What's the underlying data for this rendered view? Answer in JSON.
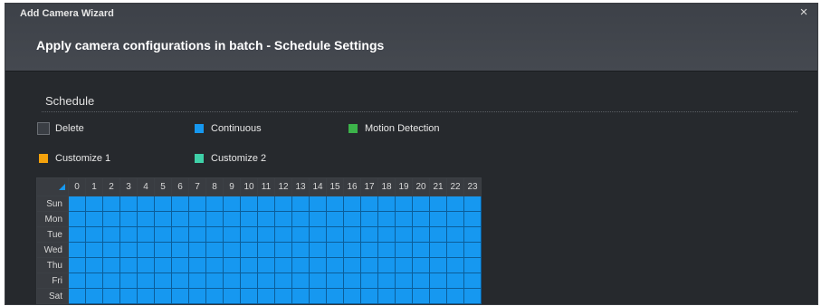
{
  "window": {
    "title": "Add Camera Wizard",
    "close_glyph": "×"
  },
  "heading": "Apply camera configurations in batch - Schedule Settings",
  "section": {
    "label": "Schedule"
  },
  "legend": {
    "delete": {
      "label": "Delete",
      "color": "#3a3e44"
    },
    "continuous": {
      "label": "Continuous",
      "color": "#1698f0"
    },
    "motion": {
      "label": "Motion Detection",
      "color": "#3cb34a"
    },
    "custom1": {
      "label": "Customize 1",
      "color": "#f4a20c"
    },
    "custom2": {
      "label": "Customize 2",
      "color": "#3fd0a8"
    }
  },
  "schedule": {
    "hours": [
      "0",
      "1",
      "2",
      "3",
      "4",
      "5",
      "6",
      "7",
      "8",
      "9",
      "10",
      "11",
      "12",
      "13",
      "14",
      "15",
      "16",
      "17",
      "18",
      "19",
      "20",
      "21",
      "22",
      "23"
    ],
    "days": [
      "Sun",
      "Mon",
      "Tue",
      "Wed",
      "Thu",
      "Fri",
      "Sat"
    ],
    "fill_mode": "continuous",
    "fill_color": "#1698f0"
  }
}
